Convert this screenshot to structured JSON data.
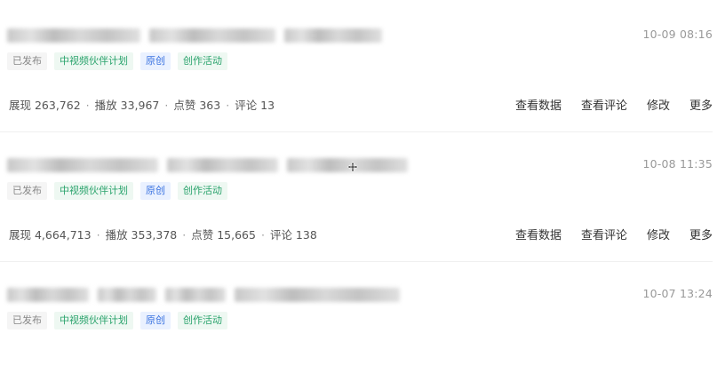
{
  "items": [
    {
      "time": "10-09 08:16",
      "tags": [
        "已发布",
        "中视频伙伴计划",
        "原创",
        "创作活动"
      ],
      "stats": {
        "views": "展现 263,762",
        "plays": "播放 33,967",
        "likes": "点赞 363",
        "comments": "评论 13"
      },
      "actions": [
        "查看数据",
        "查看评论",
        "修改",
        "更多"
      ]
    },
    {
      "time": "10-08 11:35",
      "tags": [
        "已发布",
        "中视频伙伴计划",
        "原创",
        "创作活动"
      ],
      "stats": {
        "views": "展现 4,664,713",
        "plays": "播放 353,378",
        "likes": "点赞 15,665",
        "comments": "评论 138"
      },
      "actions": [
        "查看数据",
        "查看评论",
        "修改",
        "更多"
      ]
    },
    {
      "time": "10-07 13:24",
      "tags": [
        "已发布",
        "中视频伙伴计划",
        "原创",
        "创作活动"
      ]
    }
  ],
  "separator": "·",
  "icons": {
    "cursor": "move-cursor-icon"
  },
  "colors": {
    "tag_green": "#2aa36c",
    "tag_blue": "#3b73e0",
    "muted": "#999999"
  }
}
